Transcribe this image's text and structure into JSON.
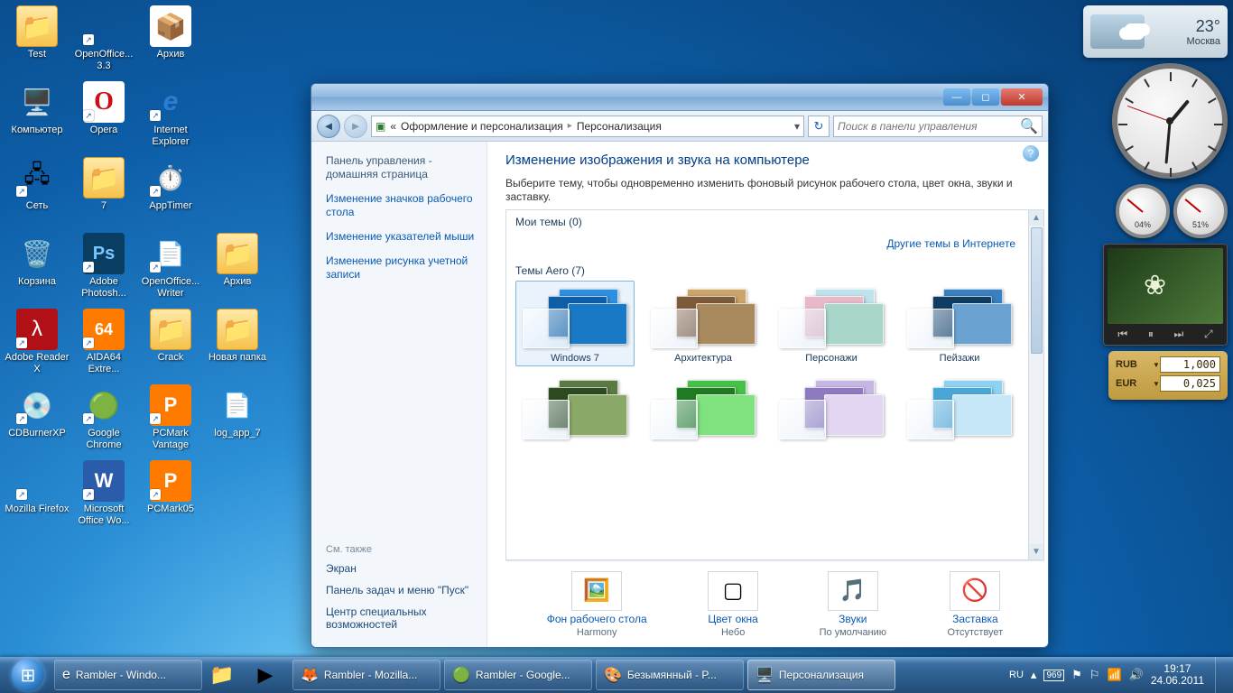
{
  "desktop_icons": [
    {
      "label": "Test",
      "icon": "folder"
    },
    {
      "label": "OpenOffice... 3.3",
      "icon": "ooo",
      "shortcut": true
    },
    {
      "label": "Архив",
      "icon": "zip"
    },
    {
      "label": "",
      "icon": ""
    },
    {
      "label": "Компьютер",
      "icon": "computer"
    },
    {
      "label": "Opera",
      "icon": "opera",
      "shortcut": true
    },
    {
      "label": "Internet Explorer",
      "icon": "ie",
      "shortcut": true
    },
    {
      "label": "",
      "icon": ""
    },
    {
      "label": "Сеть",
      "icon": "net",
      "shortcut": true
    },
    {
      "label": "7",
      "icon": "folder"
    },
    {
      "label": "AppTimer",
      "icon": "clock",
      "shortcut": true
    },
    {
      "label": "",
      "icon": ""
    },
    {
      "label": "Корзина",
      "icon": "bin"
    },
    {
      "label": "Adobe Photosh...",
      "icon": "ps",
      "shortcut": true
    },
    {
      "label": "OpenOffice... Writer",
      "icon": "writer",
      "shortcut": true
    },
    {
      "label": "Архив",
      "icon": "folder"
    },
    {
      "label": "Adobe Reader X",
      "icon": "adobe",
      "shortcut": true
    },
    {
      "label": "AIDA64 Extre...",
      "icon": "aida",
      "shortcut": true
    },
    {
      "label": "Crack",
      "icon": "folder"
    },
    {
      "label": "Новая папка",
      "icon": "folder"
    },
    {
      "label": "CDBurnerXP",
      "icon": "cdb",
      "shortcut": true
    },
    {
      "label": "Google Chrome",
      "icon": "chrome",
      "shortcut": true
    },
    {
      "label": "PCMark Vantage",
      "icon": "pcmark",
      "shortcut": true
    },
    {
      "label": "log_app_7",
      "icon": "txt"
    },
    {
      "label": "Mozilla Firefox",
      "icon": "ff",
      "shortcut": true
    },
    {
      "label": "Microsoft Office Wo...",
      "icon": "word",
      "shortcut": true
    },
    {
      "label": "PCMark05",
      "icon": "pcmark",
      "shortcut": true
    }
  ],
  "gadgets": {
    "weather": {
      "temp": "23°",
      "city": "Москва"
    },
    "cpu": {
      "label": "04%"
    },
    "ram": {
      "label": "51%"
    },
    "currency": [
      {
        "code": "RUB",
        "arrow": "▼",
        "value": "1,000"
      },
      {
        "code": "EUR",
        "arrow": "▼",
        "value": "0,025"
      }
    ]
  },
  "window": {
    "breadcrumb": {
      "prefix": "«",
      "a": "Оформление и персонализация",
      "b": "Персонализация"
    },
    "search_placeholder": "Поиск в панели управления",
    "sidebar": {
      "home": "Панель управления - домашняя страница",
      "links": [
        "Изменение значков рабочего стола",
        "Изменение указателей мыши",
        "Изменение рисунка учетной записи"
      ],
      "seealso_hdr": "См. также",
      "seealso": [
        "Экран",
        "Панель задач и меню \"Пуск\"",
        "Центр специальных возможностей"
      ]
    },
    "title": "Изменение изображения и звука на компьютере",
    "desc": "Выберите тему, чтобы одновременно изменить фоновый рисунок рабочего стола, цвет окна, звуки и заставку.",
    "mythemes_hdr": "Мои темы (0)",
    "more_link": "Другие темы в Интернете",
    "aero_hdr": "Темы Aero (7)",
    "themes": [
      {
        "name": "Windows 7",
        "colors": [
          "#2e8fe0",
          "#0e5fa8",
          "#1a79c4"
        ],
        "selected": true
      },
      {
        "name": "Архитектура",
        "colors": [
          "#cba46a",
          "#7d5a39",
          "#a98a5e"
        ]
      },
      {
        "name": "Персонажи",
        "colors": [
          "#bfe3ec",
          "#e7b9c8",
          "#a8d6cb"
        ]
      },
      {
        "name": "Пейзажи",
        "colors": [
          "#3a7fc0",
          "#0f3c63",
          "#6aa3d2"
        ]
      },
      {
        "name": "",
        "colors": [
          "#5a7a42",
          "#2d4a20",
          "#8aa867"
        ]
      },
      {
        "name": "",
        "colors": [
          "#47c04a",
          "#1f7a22",
          "#7fe27f"
        ]
      },
      {
        "name": "",
        "colors": [
          "#c6b6e2",
          "#8e7ac0",
          "#e2d6f2"
        ]
      },
      {
        "name": "",
        "colors": [
          "#8fd1f0",
          "#4aa6d6",
          "#c6e7f7"
        ]
      }
    ],
    "bottom": [
      {
        "title": "Фон рабочего стола",
        "value": "Harmony",
        "icon": "bg"
      },
      {
        "title": "Цвет окна",
        "value": "Небо",
        "icon": "color"
      },
      {
        "title": "Звуки",
        "value": "По умолчанию",
        "icon": "sound"
      },
      {
        "title": "Заставка",
        "value": "Отсутствует",
        "icon": "saver"
      }
    ]
  },
  "taskbar": {
    "items": [
      {
        "label": "Rambler - Windo...",
        "icon": "ie",
        "active": false
      },
      {
        "label": "",
        "icon": "explorer",
        "pinned": true
      },
      {
        "label": "",
        "icon": "wmp",
        "pinned": true
      },
      {
        "label": "Rambler - Mozilla...",
        "icon": "ff"
      },
      {
        "label": "Rambler - Google...",
        "icon": "chrome"
      },
      {
        "label": "Безымянный - P...",
        "icon": "paint"
      },
      {
        "label": "Персонализация",
        "icon": "personalize",
        "active": true
      }
    ],
    "lang": "RU",
    "time": "19:17",
    "date": "24.06.2011"
  }
}
